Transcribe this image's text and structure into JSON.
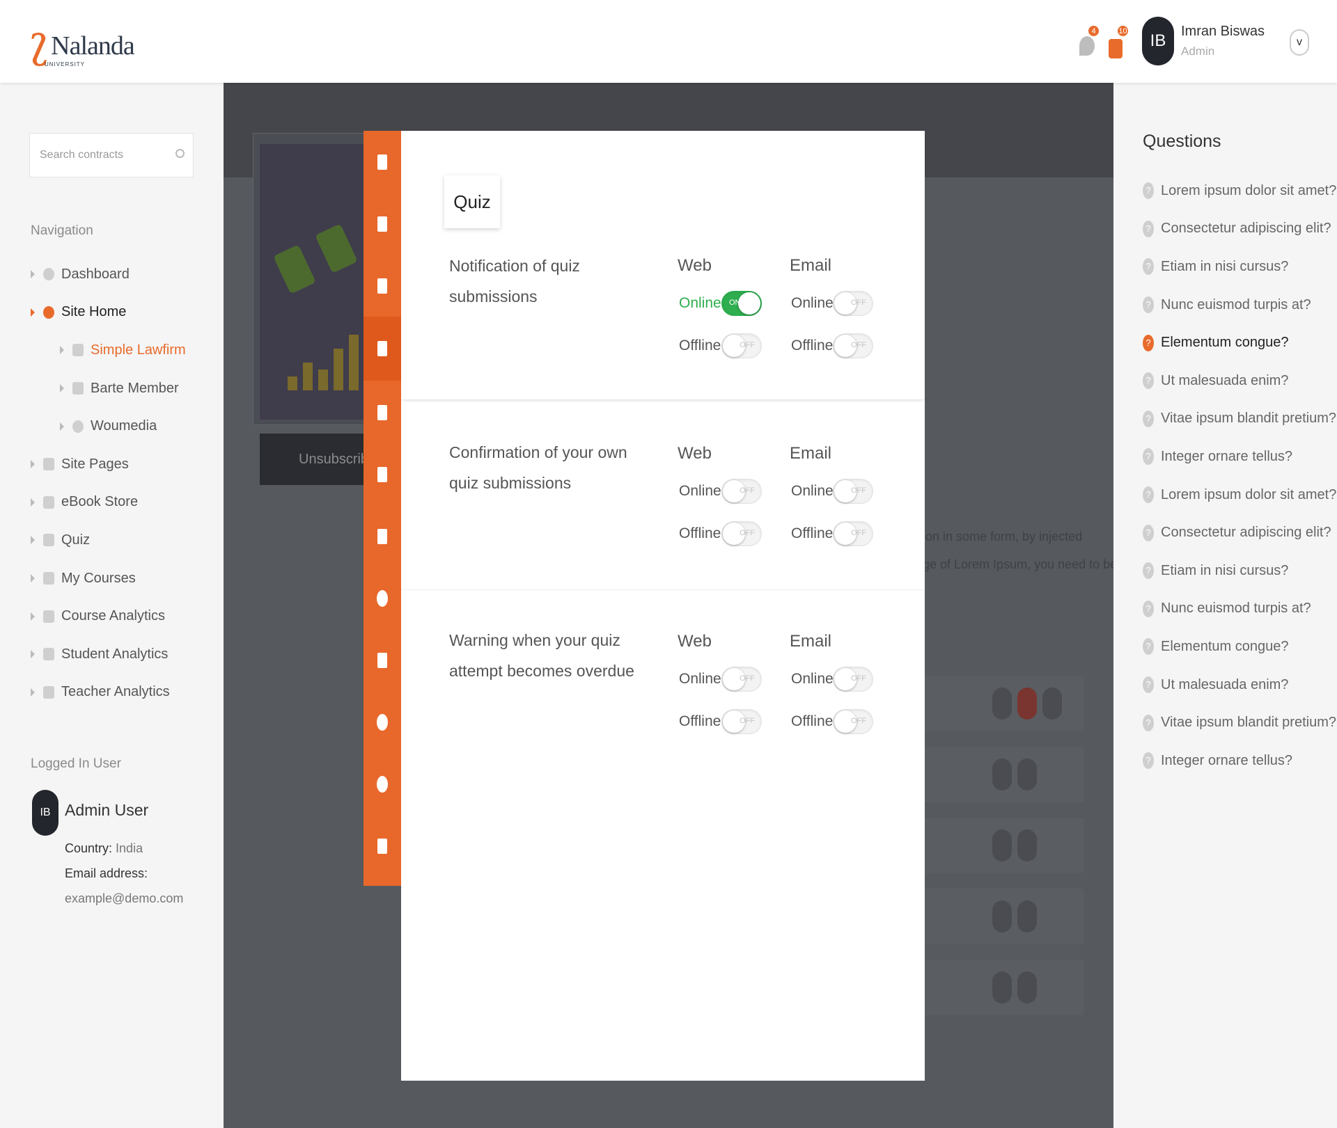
{
  "header": {
    "logo_name": "Nalanda",
    "logo_sub": "UNIVERSITY",
    "notifications_count": "4",
    "cart_count": "10",
    "user_initials": "IB",
    "user_name": "Imran Biswas",
    "user_role": "Admin",
    "dropdown_glyph": "v"
  },
  "left": {
    "search_placeholder": "Search contracts",
    "nav_title": "Navigation",
    "nav_items": [
      {
        "label": "Dashboard"
      },
      {
        "label": "Site Home"
      },
      {
        "label": "Simple Lawfirm"
      },
      {
        "label": "Barte Member"
      },
      {
        "label": "Woumedia"
      },
      {
        "label": "Site Pages"
      },
      {
        "label": "eBook Store"
      },
      {
        "label": "Quiz"
      },
      {
        "label": "My Courses"
      },
      {
        "label": "Course Analytics"
      },
      {
        "label": "Student Analytics"
      },
      {
        "label": "Teacher Analytics"
      }
    ],
    "logged_title": "Logged In User",
    "user_initials": "IB",
    "user_name": "Admin User",
    "country_label": "Country:",
    "country_value": "India",
    "email_label": "Email address:",
    "email_value": "example@demo.com"
  },
  "background": {
    "unsubscribe_label": "Unsubscribe N",
    "text_line1": "ion in some form, by injected",
    "text_line2": "ge of Lorem Ipsum, you need to be"
  },
  "modal": {
    "title": "Quiz",
    "web_label": "Web",
    "email_label": "Email",
    "online_label": "Online",
    "offline_label": "Offline",
    "on_text": "ON",
    "off_text": "OFF",
    "sections": [
      {
        "label": "Notification of quiz submissions",
        "web_online": true,
        "web_offline": false,
        "email_online": false,
        "email_offline": false
      },
      {
        "label": "Confirmation of your own quiz submissions",
        "web_online": false,
        "web_offline": false,
        "email_online": false,
        "email_offline": false
      },
      {
        "label": "Warning when your quiz attempt becomes overdue",
        "web_online": false,
        "web_offline": false,
        "email_online": false,
        "email_offline": false
      }
    ]
  },
  "tabbar_icons": [
    "clipboard-icon",
    "badge-icon",
    "chat-icon",
    "document-icon",
    "note-icon",
    "sliders-icon",
    "edit-icon",
    "user-icon",
    "card-icon",
    "palette-icon",
    "gear-icon",
    "presentation-icon"
  ],
  "right": {
    "title": "Questions",
    "questions": [
      "Lorem ipsum dolor sit amet?",
      "Consectetur adipiscing elit?",
      "Etiam in nisi cursus?",
      "Nunc euismod turpis at?",
      "Elementum congue?",
      "Ut malesuada enim?",
      "Vitae ipsum blandit pretium?",
      "Integer ornare tellus?",
      "Lorem ipsum dolor sit amet?",
      "Consectetur adipiscing elit?",
      "Etiam in nisi cursus?",
      "Nunc euismod turpis at?",
      "Elementum congue?",
      "Ut malesuada enim?",
      "Vitae ipsum blandit pretium?",
      "Integer ornare tellus?"
    ]
  },
  "colors": {
    "accent": "#e86b2c",
    "toggle_on": "#2eae4e",
    "overlay": "#56595e"
  }
}
